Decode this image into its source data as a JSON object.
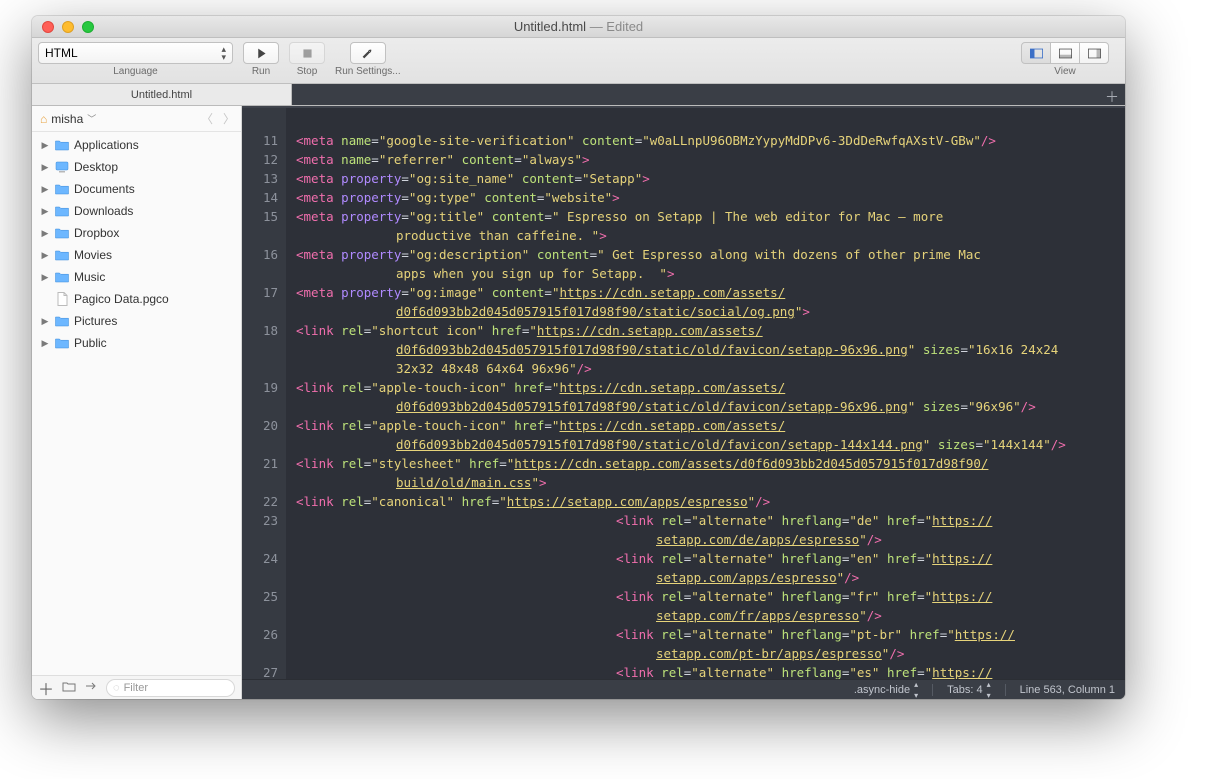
{
  "title": {
    "name": "Untitled.html",
    "edited": "— Edited"
  },
  "toolbar": {
    "language": {
      "label": "Language",
      "value": "HTML"
    },
    "run": "Run",
    "stop": "Stop",
    "runSettings": "Run Settings...",
    "view": "View"
  },
  "tabs": {
    "file": "Untitled.html"
  },
  "crumb": {
    "user": "misha"
  },
  "tree": [
    {
      "kind": "folder",
      "name": "Applications"
    },
    {
      "kind": "desktop",
      "name": "Desktop"
    },
    {
      "kind": "folder",
      "name": "Documents"
    },
    {
      "kind": "folder",
      "name": "Downloads"
    },
    {
      "kind": "folder",
      "name": "Dropbox"
    },
    {
      "kind": "folder",
      "name": "Movies"
    },
    {
      "kind": "folder",
      "name": "Music"
    },
    {
      "kind": "file",
      "name": "Pagico Data.pgco"
    },
    {
      "kind": "folder",
      "name": "Pictures"
    },
    {
      "kind": "folder",
      "name": "Public"
    }
  ],
  "filterPlaceholder": "Filter",
  "lineNumbers": [
    "",
    "11",
    "12",
    "13",
    "14",
    "15",
    "",
    "16",
    "",
    "17",
    "",
    "18",
    "",
    "",
    "19",
    "",
    "20",
    "",
    "21",
    "",
    "22",
    "23",
    "",
    "24",
    "",
    "25",
    "",
    "26",
    "",
    "27"
  ],
  "status": {
    "scope": ".async-hide",
    "tabs": "Tabs: 4",
    "pos": "Line 563, Column 1"
  }
}
